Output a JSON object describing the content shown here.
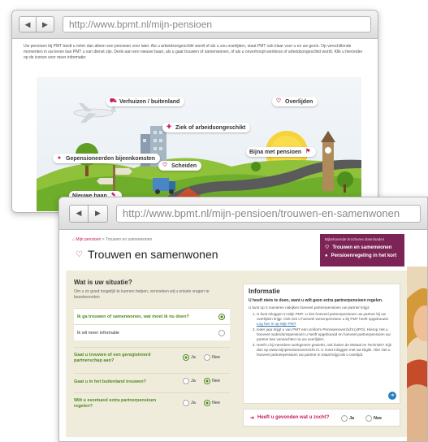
{
  "back_window": {
    "url": "http://www.bpmt.nl/mijn-pensioen",
    "intro": "Uw pensioen bij PMT biedt u méér dan alleen een pensioen voor later. Als u arbeidsongeschikt wordt of als u zou overlijden, staat PMT ook klaar voor u en uw gezin. Op verschillende momenten in uw leven kan PMT u van dienst zijn. Denk aan een nieuwe baan, als u gaat trouwen of samenwonen, of als u onverhoopt werkloos of arbeidsongeschikt wordt. Klik u hieronder op de iconen voor meer informatie:",
    "topics": {
      "verhuizen": "Verhuizen / buitenland",
      "overlijden": "Overlijden",
      "ziek": "Ziek of arbeidsongeschikt",
      "gepensioneerden": "Gepensioneerden bijeenkomsten",
      "bijna": "Bijna met pensioen",
      "scheiden": "Scheiden",
      "nieuwe_baan": "Nieuwe baan"
    }
  },
  "front_window": {
    "url": "http://www.bpmt.nl/mijn-pensioen/trouwen-en-samenwonen",
    "breadcrumb_current": "Mijn pensioen",
    "breadcrumb_sep": " > Trouwen en samenwonen",
    "page_title": "Trouwen en samenwonen",
    "downloads": {
      "heading": "Bijbehorende brochures downloaden",
      "items": [
        "Trouwen en samenwonen",
        "Pensioenregeling in het kort"
      ]
    },
    "situation": {
      "heading": "Wat is uw situatie?",
      "intro": "Om u zo goed mogelijk te kunnen helpen, verzoeken wij u enkele vragen te beantwoorden",
      "q1": "Ik ga trouwen of samenwonen, wat moet ik nu doen?",
      "q1b": "Ik wil meer informatie",
      "q2": "Gaat u trouwen of een geregistreerd partnerschap aan?",
      "q3": "Gaat u in het buitenland trouwen?",
      "q4": "Wilt u eventueel extra partnerpensioen regelen?",
      "ja": "Ja",
      "nee": "Nee"
    },
    "info": {
      "heading": "Informatie",
      "bold": "U hoeft niets te doen, want u wilt geen extra partnerpensioen regelen.",
      "lead": "U kunt op 3 manieren nakijken hoeveel partnerpensioen uw partner krijgt:",
      "steps": [
        "U kunt inloggen in Mijn PMT. U ziet hoeveel partnerpensioen uw partner bij uw overlijden krijgt. Ook ziet u hoeveel wezenpensioen u bij PMT heeft opgebouwd.",
        "Log hier in op Mijn PMT",
        "Ieder jaar krijgt u van PMT een Uniform Pensioenoverzicht (UPO). Hierop ziet u hoeveel ouderdomspensioen u heeft opgebouwd en hoeveel partnerpensioen uw partner kan verwachten na uw overlijden.",
        "Heeft u bij meerdere werkgevers gewerkt, ook buiten de Metaal en Techniek? Kijk dan op www.mijnpensioenoverzicht.nl. U moet inloggen met uw DigiD. Hier ziet u hoeveel partnerpensioen uw partner in totaal krijgt als u overlijdt."
      ]
    },
    "feedback": "Heeft u gevonden wat u zocht?"
  }
}
